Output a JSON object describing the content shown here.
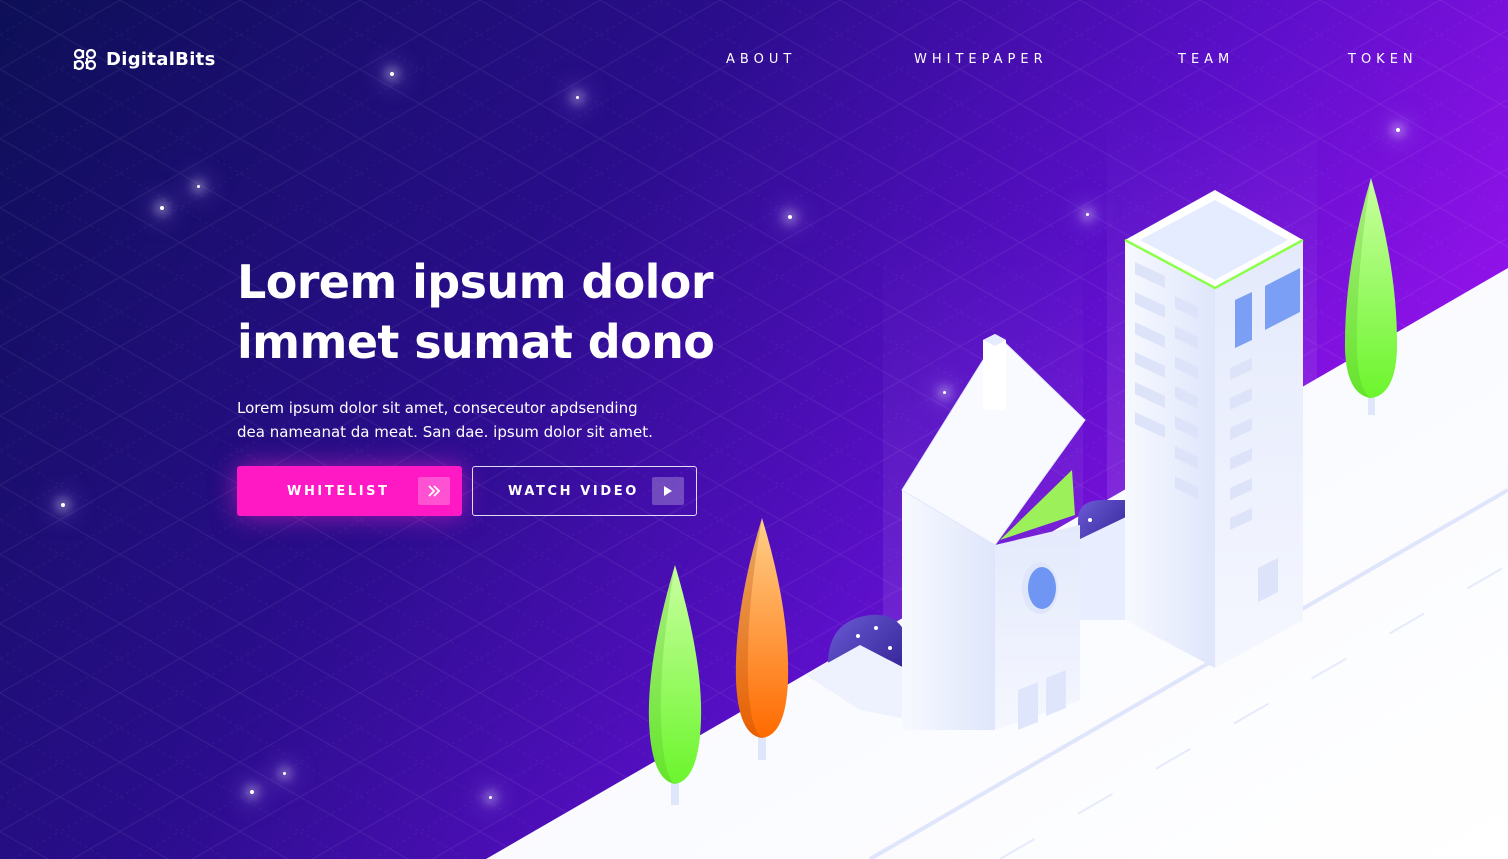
{
  "brand": {
    "name": "DigitalBits",
    "logo_icon": "digitalbits-logo-icon"
  },
  "nav": {
    "items": [
      {
        "label": "ABOUT"
      },
      {
        "label": "WHITEPAPER"
      },
      {
        "label": "TEAM"
      },
      {
        "label": "TOKEN"
      }
    ]
  },
  "hero": {
    "title_line1": "Lorem ipsum dolor",
    "title_line2": "immet sumat dono",
    "subtitle_line1": "Lorem ipsum dolor sit amet, conseceutor apdsending",
    "subtitle_line2": "dea nameanat da meat. San dae. ipsum dolor sit amet."
  },
  "buttons": {
    "whitelist": {
      "label": "WHITELIST",
      "icon": "double-chevron-right-icon"
    },
    "watch_video": {
      "label": "WATCH VIDEO",
      "icon": "play-icon"
    }
  },
  "colors": {
    "background_start": "#0d0f57",
    "background_end": "#a814f2",
    "accent_pink": "#ff19c4",
    "tree_green": "#7dff3a",
    "tree_orange": "#ff7a00",
    "building_white": "#f3f6ff"
  }
}
